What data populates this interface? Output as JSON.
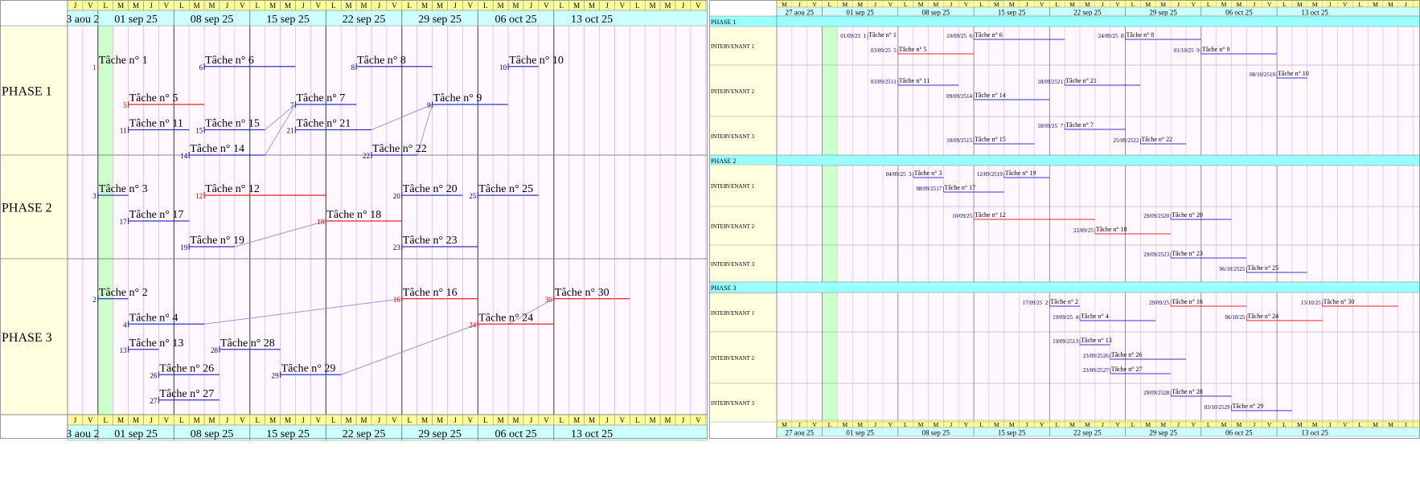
{
  "colors": {
    "day_header_bg": "#ffff99",
    "week_header_bg": "#ccffff",
    "phase_label_bg": "#ffffe0",
    "chart_bg": "#fff8ff",
    "today_col": "#ccffcc",
    "normal_bar": "#3333cc",
    "critical_bar": "#ee2222",
    "link_line": "#9999dd",
    "phase_band": "#99ffff"
  },
  "left": {
    "days": [
      "J",
      "V",
      "L",
      "M",
      "M",
      "J",
      "V",
      "L",
      "M",
      "M",
      "J",
      "V",
      "L",
      "M",
      "M",
      "J",
      "V",
      "L",
      "M",
      "M",
      "J",
      "V",
      "L",
      "M",
      "M",
      "J",
      "V",
      "L",
      "M",
      "M",
      "J",
      "V",
      "L",
      "M",
      "M",
      "J",
      "V",
      "L",
      "M",
      "M",
      "J",
      "V"
    ],
    "week_labels": [
      "3 aou 2",
      "01 sep 25",
      "08 sep 25",
      "15 sep 25",
      "22 sep 25",
      "29 sep 25",
      "06 oct 25",
      "13 oct 25"
    ],
    "phases": [
      {
        "label": "PHASE 1",
        "tasks": [
          {
            "num": "1",
            "label": "Tâche n° 1",
            "row": 0.5,
            "s": 2,
            "e": 2,
            "crit": true
          },
          {
            "num": "5",
            "label": "Tâche n° 5",
            "row": 2.0,
            "s": 4,
            "e": 9,
            "crit": true
          },
          {
            "num": "6",
            "label": "Tâche n° 6",
            "row": 0.5,
            "s": 9,
            "e": 15,
            "crit": false
          },
          {
            "num": "11",
            "label": "Tâche n° 11",
            "row": 3.0,
            "s": 4,
            "e": 8,
            "crit": false
          },
          {
            "num": "15",
            "label": "Tâche n° 15",
            "row": 3.0,
            "s": 9,
            "e": 13,
            "crit": false
          },
          {
            "num": "14",
            "label": "Tâche n° 14",
            "row": 4.0,
            "s": 8,
            "e": 13,
            "crit": false
          },
          {
            "num": "7",
            "label": "Tâche n° 7",
            "row": 2.0,
            "s": 15,
            "e": 19,
            "crit": false
          },
          {
            "num": "21",
            "label": "Tâche n° 21",
            "row": 3.0,
            "s": 15,
            "e": 20,
            "crit": false
          },
          {
            "num": "8",
            "label": "Tâche n° 8",
            "row": 0.5,
            "s": 19,
            "e": 24,
            "crit": false
          },
          {
            "num": "22",
            "label": "Tâche n° 22",
            "row": 4.0,
            "s": 20,
            "e": 23,
            "crit": false
          },
          {
            "num": "9",
            "label": "Tâche n° 9",
            "row": 2.0,
            "s": 24,
            "e": 29,
            "crit": false
          },
          {
            "num": "10",
            "label": "Tâche n° 10",
            "row": 0.5,
            "s": 29,
            "e": 31,
            "crit": false
          }
        ]
      },
      {
        "label": "PHASE 2",
        "tasks": [
          {
            "num": "3",
            "label": "Tâche n° 3",
            "row": 0.5,
            "s": 2,
            "e": 4,
            "crit": false
          },
          {
            "num": "12",
            "label": "Tâche n° 12",
            "row": 0.5,
            "s": 9,
            "e": 17,
            "crit": true
          },
          {
            "num": "17",
            "label": "Tâche n° 17",
            "row": 1.5,
            "s": 4,
            "e": 8,
            "crit": false
          },
          {
            "num": "19",
            "label": "Tâche n° 19",
            "row": 2.5,
            "s": 8,
            "e": 11,
            "crit": false
          },
          {
            "num": "18",
            "label": "Tâche n° 18",
            "row": 1.5,
            "s": 17,
            "e": 22,
            "crit": true
          },
          {
            "num": "20",
            "label": "Tâche n° 20",
            "row": 0.5,
            "s": 22,
            "e": 26,
            "crit": false
          },
          {
            "num": "25",
            "label": "Tâche n° 25",
            "row": 0.5,
            "s": 27,
            "e": 31,
            "crit": false
          },
          {
            "num": "23",
            "label": "Tâche n° 23",
            "row": 2.5,
            "s": 22,
            "e": 27,
            "crit": false
          }
        ]
      },
      {
        "label": "PHASE 3",
        "tasks": [
          {
            "num": "2",
            "label": "Tâche n° 2",
            "row": 0.5,
            "s": 2,
            "e": 4,
            "crit": false
          },
          {
            "num": "16",
            "label": "Tâche n° 16",
            "row": 0.5,
            "s": 22,
            "e": 27,
            "crit": true
          },
          {
            "num": "30",
            "label": "Tâche n° 30",
            "row": 0.5,
            "s": 32,
            "e": 37,
            "crit": true
          },
          {
            "num": "4",
            "label": "Tâche n° 4",
            "row": 1.5,
            "s": 4,
            "e": 9,
            "crit": false
          },
          {
            "num": "24",
            "label": "Tâche n° 24",
            "row": 1.5,
            "s": 27,
            "e": 32,
            "crit": true
          },
          {
            "num": "13",
            "label": "Tâche n° 13",
            "row": 2.5,
            "s": 4,
            "e": 6,
            "crit": false
          },
          {
            "num": "28",
            "label": "Tâche n° 28",
            "row": 2.5,
            "s": 10,
            "e": 14,
            "crit": false
          },
          {
            "num": "26",
            "label": "Tâche n° 26",
            "row": 3.5,
            "s": 6,
            "e": 10,
            "crit": false
          },
          {
            "num": "29",
            "label": "Tâche n° 29",
            "row": 3.5,
            "s": 14,
            "e": 18,
            "crit": false
          },
          {
            "num": "27",
            "label": "Tâche n° 27",
            "row": 4.5,
            "s": 6,
            "e": 10,
            "crit": false
          }
        ]
      }
    ],
    "links": [
      {
        "from": [
          0,
          4.0,
          13
        ],
        "to": [
          0,
          2.0,
          15
        ]
      },
      {
        "from": [
          0,
          3.0,
          13
        ],
        "to": [
          0,
          2.0,
          15
        ]
      },
      {
        "from": [
          0,
          4.0,
          23
        ],
        "to": [
          0,
          2.0,
          24
        ]
      },
      {
        "from": [
          0,
          3.0,
          20
        ],
        "to": [
          0,
          2.0,
          24
        ]
      },
      {
        "from": [
          1,
          2.5,
          11
        ],
        "to": [
          1,
          1.5,
          17
        ]
      },
      {
        "from": [
          2,
          1.5,
          9
        ],
        "to": [
          2,
          0.5,
          22
        ]
      },
      {
        "from": [
          2,
          3.5,
          18
        ],
        "to": [
          2,
          1.5,
          27
        ]
      },
      {
        "from": [
          2,
          1.5,
          29
        ],
        "to": [
          2,
          0.5,
          32
        ]
      }
    ]
  },
  "right": {
    "days": [
      "M",
      "J",
      "V",
      "L",
      "M",
      "M",
      "J",
      "V",
      "L",
      "M",
      "M",
      "J",
      "V",
      "L",
      "M",
      "M",
      "J",
      "V",
      "L",
      "M",
      "M",
      "J",
      "V",
      "L",
      "M",
      "M",
      "J",
      "V",
      "L",
      "M",
      "M",
      "J",
      "V",
      "L",
      "M",
      "M",
      "J",
      "V",
      "L",
      "M",
      "M",
      "J",
      "V"
    ],
    "week_labels": [
      "27 aou 25",
      "01 sep 25",
      "08 sep 25",
      "15 sep 25",
      "22 sep 25",
      "29 sep 25",
      "06 oct 25",
      "13 oct 25"
    ],
    "phases": [
      {
        "label": "PHASE 1",
        "rows": [
          {
            "label": "INTERVENANT 1",
            "tasks": [
              {
                "date": "01/09/25",
                "num": "1",
                "label": "Tâche n° 1",
                "sub": 0,
                "s": 6,
                "e": 6,
                "crit": true
              },
              {
                "date": "03/09/25",
                "num": "5",
                "label": "Tâche n° 5",
                "sub": 1,
                "s": 8,
                "e": 13,
                "crit": true
              },
              {
                "date": "10/09/25",
                "num": "6",
                "label": "Tâche n° 6",
                "sub": 0,
                "s": 13,
                "e": 19,
                "crit": false
              },
              {
                "date": "24/09/25",
                "num": "8",
                "label": "Tâche n° 8",
                "sub": 0,
                "s": 23,
                "e": 28,
                "crit": false
              },
              {
                "date": "01/10/25",
                "num": "9",
                "label": "Tâche n° 9",
                "sub": 1,
                "s": 28,
                "e": 33,
                "crit": false
              }
            ]
          },
          {
            "label": "INTERVENANT 2",
            "tasks": [
              {
                "date": "03/09/25",
                "num": "11",
                "label": "Tâche n° 11",
                "sub": 0.5,
                "s": 8,
                "e": 12,
                "crit": false
              },
              {
                "date": "09/09/25",
                "num": "14",
                "label": "Tâche n° 14",
                "sub": 1.5,
                "s": 13,
                "e": 18,
                "crit": false
              },
              {
                "date": "18/09/25",
                "num": "21",
                "label": "Tâche n° 21",
                "sub": 0.5,
                "s": 19,
                "e": 24,
                "crit": false
              },
              {
                "date": "08/10/25",
                "num": "10",
                "label": "Tâche n° 10",
                "sub": 0,
                "s": 33,
                "e": 35,
                "crit": false
              }
            ]
          },
          {
            "label": "INTERVENANT 3",
            "tasks": [
              {
                "date": "18/09/25",
                "num": "7",
                "label": "Tâche n° 7",
                "sub": 0,
                "s": 19,
                "e": 23,
                "crit": false
              },
              {
                "date": "10/09/25",
                "num": "15",
                "label": "Tâche n° 15",
                "sub": 1,
                "s": 13,
                "e": 17,
                "crit": false
              },
              {
                "date": "25/09/25",
                "num": "22",
                "label": "Tâche n° 22",
                "sub": 1,
                "s": 24,
                "e": 27,
                "crit": false
              }
            ]
          }
        ]
      },
      {
        "label": "PHASE 2",
        "rows": [
          {
            "label": "INTERVENANT 1",
            "tasks": [
              {
                "date": "04/09/25",
                "num": "3",
                "label": "Tâche n° 3",
                "sub": 0,
                "s": 9,
                "e": 11,
                "crit": false
              },
              {
                "date": "12/09/25",
                "num": "19",
                "label": "Tâche n° 19",
                "sub": 0,
                "s": 15,
                "e": 18,
                "crit": false
              },
              {
                "date": "08/09/25",
                "num": "17",
                "label": "Tâche n° 17",
                "sub": 1,
                "s": 11,
                "e": 15,
                "crit": false
              }
            ]
          },
          {
            "label": "INTERVENANT 2",
            "tasks": [
              {
                "date": "10/09/25",
                "num": "",
                "label": "Tâche n° 12",
                "sub": 0,
                "s": 13,
                "e": 21,
                "crit": true
              },
              {
                "date": "29/09/25",
                "num": "20",
                "label": "Tâche n° 20",
                "sub": 0,
                "s": 26,
                "e": 30,
                "crit": false
              },
              {
                "date": "22/09/25",
                "num": "",
                "label": "Tâche n° 18",
                "sub": 1,
                "s": 21,
                "e": 26,
                "crit": true
              }
            ]
          },
          {
            "label": "INTERVENANT 3",
            "tasks": [
              {
                "date": "29/09/25",
                "num": "23",
                "label": "Tâche n° 23",
                "sub": 0,
                "s": 26,
                "e": 31,
                "crit": false
              },
              {
                "date": "06/10/25",
                "num": "25",
                "label": "Tâche n° 25",
                "sub": 1,
                "s": 31,
                "e": 35,
                "crit": false
              }
            ]
          }
        ]
      },
      {
        "label": "PHASE 3",
        "rows": [
          {
            "label": "INTERVENANT 1",
            "tasks": [
              {
                "date": "17/09/25",
                "num": "2",
                "label": "Tâche n° 2",
                "sub": 0,
                "s": 18,
                "e": 20,
                "crit": false
              },
              {
                "date": "29/09/25",
                "num": "",
                "label": "Tâche n° 16",
                "sub": 0,
                "s": 26,
                "e": 31,
                "crit": true
              },
              {
                "date": "13/10/25",
                "num": "",
                "label": "Tâche n° 30",
                "sub": 0,
                "s": 36,
                "e": 41,
                "crit": true
              },
              {
                "date": "19/09/25",
                "num": "4",
                "label": "Tâche n° 4",
                "sub": 1,
                "s": 20,
                "e": 25,
                "crit": false
              },
              {
                "date": "06/10/25",
                "num": "",
                "label": "Tâche n° 24",
                "sub": 1,
                "s": 31,
                "e": 36,
                "crit": true
              }
            ]
          },
          {
            "label": "INTERVENANT 2",
            "tasks": [
              {
                "date": "19/09/25",
                "num": "13",
                "label": "Tâche n° 13",
                "sub": 0,
                "s": 20,
                "e": 22,
                "crit": false
              },
              {
                "date": "23/09/25",
                "num": "26",
                "label": "Tâche n° 26",
                "sub": 1,
                "s": 22,
                "e": 27,
                "crit": false
              },
              {
                "date": "23/09/25",
                "num": "27",
                "label": "Tâche n° 27",
                "sub": 2,
                "s": 22,
                "e": 26,
                "crit": false
              }
            ]
          },
          {
            "label": "INTERVENANT 3",
            "tasks": [
              {
                "date": "29/09/25",
                "num": "28",
                "label": "Tâche n° 28",
                "sub": 0,
                "s": 26,
                "e": 30,
                "crit": false
              },
              {
                "date": "03/10/25",
                "num": "29",
                "label": "Tâche n° 29",
                "sub": 1,
                "s": 30,
                "e": 34,
                "crit": false
              }
            ]
          }
        ]
      }
    ]
  }
}
